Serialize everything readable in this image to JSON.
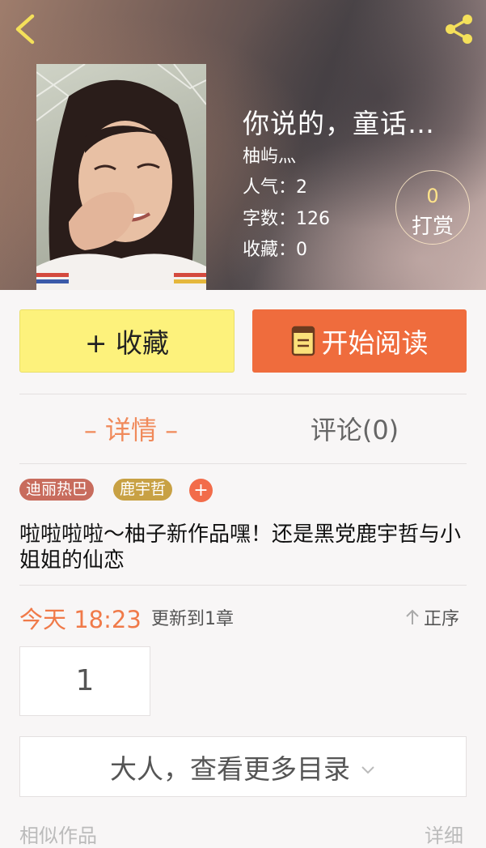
{
  "header": {
    "title": "你说的，童话…",
    "author": "柚屿灬",
    "popularity": "人气：2",
    "word_count": "字数：126",
    "favorites": "收藏：0",
    "reward_count": "0",
    "reward_label": "打赏"
  },
  "actions": {
    "favorite_label": "+ 收藏",
    "read_label": "开始阅读"
  },
  "tabs": {
    "detail": "– 详情 –",
    "comments": "评论(0)"
  },
  "tags": [
    "迪丽热巴",
    "鹿宇哲"
  ],
  "tag_add": "+",
  "description": "啦啦啦啦～柚子新作品嘿！还是黑党鹿宇哲与小姐姐的仙恋",
  "update": {
    "time": "今天 18:23",
    "info": "更新到1章",
    "sort_label": "正序"
  },
  "chapters": [
    "1"
  ],
  "more_catalog": "大人，查看更多目录",
  "bottom": {
    "left": "相似作品",
    "right": "详细"
  },
  "colors": {
    "accent_orange": "#ef6c3d",
    "favorite_yellow": "#fdf27c",
    "tab_active": "#f08a5b",
    "tag_red": "#c86c5d",
    "tag_gold": "#c8a144"
  },
  "icons": {
    "back": "chevron-left-icon",
    "share": "share-icon",
    "book": "book-icon",
    "sort": "arrow-up-icon",
    "more": "chevron-down-icon"
  }
}
